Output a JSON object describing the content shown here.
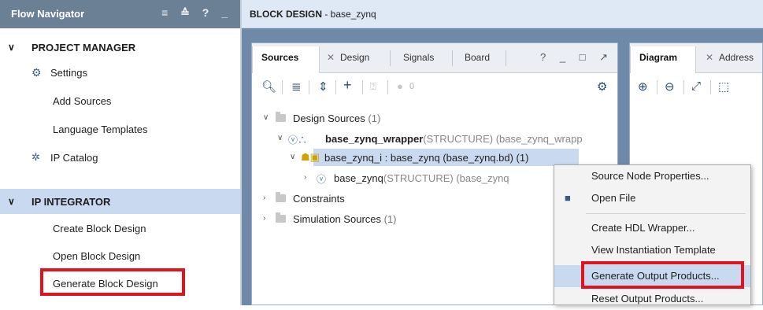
{
  "flow_navigator": {
    "title": "Flow Navigator",
    "controls": "≡ ≙ ? _",
    "project_manager": {
      "label": "PROJECT MANAGER",
      "items": [
        "Settings",
        "Add Sources",
        "Language Templates",
        "IP Catalog"
      ]
    },
    "ip_integrator": {
      "label": "IP INTEGRATOR",
      "items": [
        "Create Block Design",
        "Open Block Design",
        "Generate Block Design"
      ]
    }
  },
  "block_design": {
    "title_bold": "BLOCK DESIGN",
    "title_rest": " - base_zynq"
  },
  "sources_panel": {
    "tabs": [
      "Sources",
      "Design",
      "Signals",
      "Board"
    ],
    "controls": "? _ □ ↗",
    "toolbar_count": "0",
    "tree": {
      "design_sources": "Design Sources",
      "design_sources_count": "(1)",
      "wrapper_name": "base_zynq_wrapper",
      "wrapper_detail": "(STRUCTURE) (base_zynq_wrapp",
      "bd_item": "base_zynq_i : base_zynq (base_zynq.bd) (1)",
      "base_name": "base_zynq",
      "base_detail": "(STRUCTURE) (base_zynq",
      "constraints": "Constraints",
      "simulation_sources": "Simulation Sources",
      "simulation_sources_count": "(1)"
    }
  },
  "diagram_panel": {
    "tabs": [
      "Diagram",
      "Address"
    ]
  },
  "context_menu": {
    "items": [
      "Source Node Properties...",
      "Open File",
      "Create HDL Wrapper...",
      "View Instantiation Template",
      "Generate Output Products...",
      "Reset Output Products..."
    ]
  },
  "colors": {
    "highlight": "#e0141e",
    "selection": "#c9daf0",
    "header": "#6b7f95"
  }
}
